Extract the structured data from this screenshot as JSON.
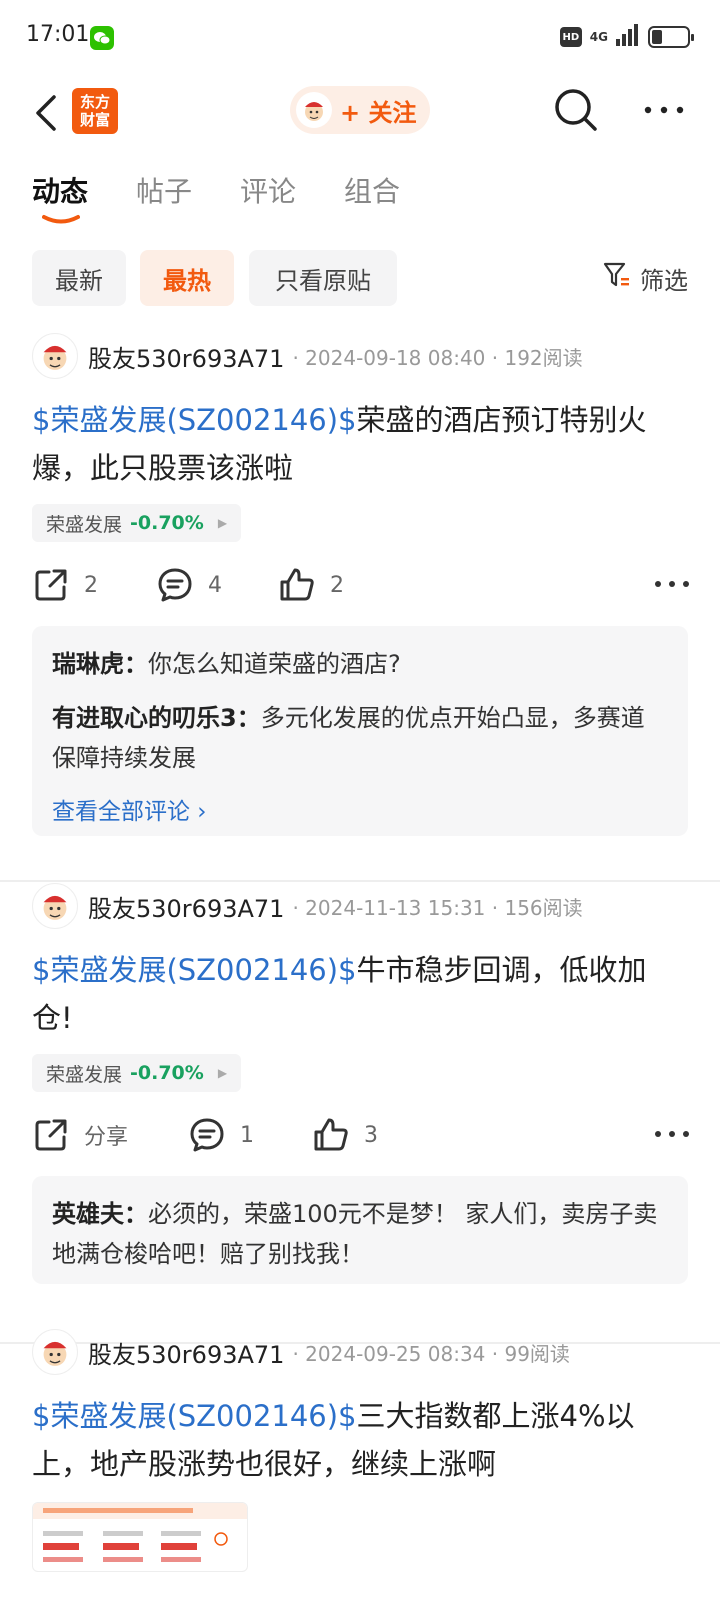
{
  "status_bar": {
    "time": "17:01",
    "hd": "HD",
    "network": "4G"
  },
  "nav": {
    "logo_line1": "东方",
    "logo_line2": "财富",
    "follow_label": "+ 关注"
  },
  "tabs": [
    {
      "label": "动态"
    },
    {
      "label": "帖子"
    },
    {
      "label": "评论"
    },
    {
      "label": "组合"
    }
  ],
  "filters": {
    "chips": [
      {
        "label": "最新"
      },
      {
        "label": "最热"
      },
      {
        "label": "只看原贴"
      }
    ],
    "filter_label": "筛选"
  },
  "posts": [
    {
      "author": "股友530r693A71",
      "meta": "· 2024-09-18 08:40 · 192阅读",
      "stock_link": "$荣盛发展(SZ002146)$",
      "text": "荣盛的酒店预订特别火爆，此只股票该涨啦",
      "tag_name": "荣盛发展",
      "tag_change": "-0.70%",
      "share": "2",
      "comments": "4",
      "likes": "2",
      "comment_list": [
        {
          "author": "瑞琳虎：",
          "text": "你怎么知道荣盛的酒店?"
        },
        {
          "author": "有进取心的叨乐3：",
          "text": "多元化发展的优点开始凸显，多赛道保障持续发展"
        }
      ],
      "view_all": "查看全部评论 ›"
    },
    {
      "author": "股友530r693A71",
      "meta": "· 2024-11-13 15:31 · 156阅读",
      "stock_link": "$荣盛发展(SZ002146)$",
      "text": "牛市稳步回调，低收加仓!",
      "tag_name": "荣盛发展",
      "tag_change": "-0.70%",
      "share": "分享",
      "comments": "1",
      "likes": "3",
      "comment_list": [
        {
          "author": "英雄夫：",
          "text": "必须的，荣盛100元不是梦！ 家人们，卖房子卖地满仓梭哈吧！赔了别找我！"
        }
      ]
    },
    {
      "author": "股友530r693A71",
      "meta": "· 2024-09-25 08:34 · 99阅读",
      "stock_link": "$荣盛发展(SZ002146)$",
      "text": "三大指数都上涨4%以上，地产股涨势也很好，继续上涨啊"
    }
  ],
  "colors": {
    "accent": "#f25a0f",
    "link": "#2b6fc9",
    "down": "#19a15f"
  }
}
